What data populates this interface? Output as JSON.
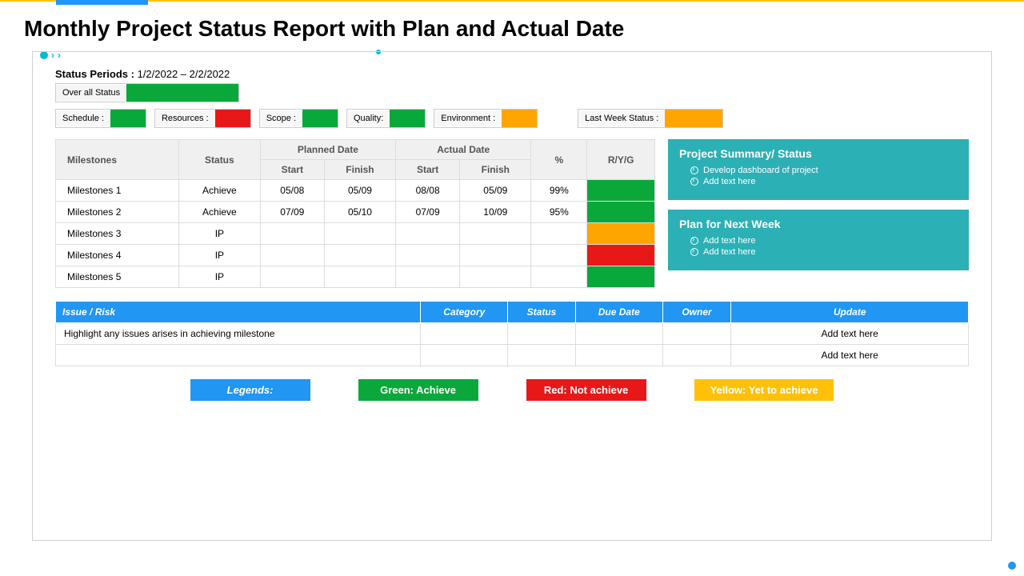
{
  "title": "Monthly Project Status Report with Plan and Actual Date",
  "status_periods_label": "Status Periods :",
  "status_periods_value": "1/2/2022 – 2/2/2022",
  "overall": {
    "label": "Over all Status",
    "color": "green"
  },
  "kpis": [
    {
      "label": "Schedule :",
      "color": "green"
    },
    {
      "label": "Resources :",
      "color": "red"
    },
    {
      "label": "Scope :",
      "color": "green"
    },
    {
      "label": "Quality:",
      "color": "green"
    },
    {
      "label": "Environment :",
      "color": "amber"
    },
    {
      "label": "Last Week Status :",
      "color": "amber",
      "wide": true
    }
  ],
  "milestone_headers": {
    "milestones": "Milestones",
    "status": "Status",
    "planned": "Planned Date",
    "actual": "Actual Date",
    "start": "Start",
    "finish": "Finish",
    "pct": "%",
    "ryg": "R/Y/G"
  },
  "milestones": [
    {
      "name": "Milestones 1",
      "status": "Achieve",
      "ps": "05/08",
      "pf": "05/09",
      "as": "08/08",
      "af": "05/09",
      "pct": "99%",
      "ryg": "green"
    },
    {
      "name": "Milestones 2",
      "status": "Achieve",
      "ps": "07/09",
      "pf": "05/10",
      "as": "07/09",
      "af": "10/09",
      "pct": "95%",
      "ryg": "green"
    },
    {
      "name": "Milestones 3",
      "status": "IP",
      "ps": "",
      "pf": "",
      "as": "",
      "af": "",
      "pct": "",
      "ryg": "amber"
    },
    {
      "name": "Milestones 4",
      "status": "IP",
      "ps": "",
      "pf": "",
      "as": "",
      "af": "",
      "pct": "",
      "ryg": "red"
    },
    {
      "name": "Milestones 5",
      "status": "IP",
      "ps": "",
      "pf": "",
      "as": "",
      "af": "",
      "pct": "",
      "ryg": "green"
    }
  ],
  "panels": {
    "summary_title": "Project Summary/ Status",
    "summary_items": [
      "Develop dashboard of project",
      "Add text here"
    ],
    "plan_title": "Plan for Next Week",
    "plan_items": [
      "Add text here",
      "Add text here"
    ]
  },
  "issues_headers": [
    "Issue / Risk",
    "Category",
    "Status",
    "Due Date",
    "Owner",
    "Update"
  ],
  "issues": [
    {
      "text": "Highlight any issues arises in achieving milestone",
      "update": "Add text here"
    },
    {
      "text": "",
      "update": "Add text here"
    }
  ],
  "legends": {
    "title": "Legends:",
    "green": "Green: Achieve",
    "red": "Red: Not achieve",
    "yellow": "Yellow: Yet to achieve"
  }
}
